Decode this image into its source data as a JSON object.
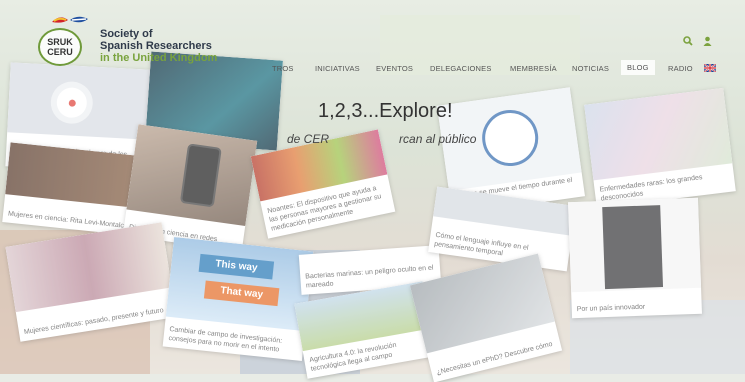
{
  "logo": {
    "badge_line1": "SRUK",
    "badge_line2": "CERU",
    "title_line1": "Society of",
    "title_line2": "Spanish Researchers",
    "title_line3": "in the United Kingdom"
  },
  "nav": {
    "items": [
      "TROS",
      "INICIATIVAS",
      "EVENTOS",
      "DELEGACIONES",
      "MEMBRESÍA",
      "NOTICIAS",
      "BLOG",
      "RADIO"
    ],
    "active": "BLOG"
  },
  "icons": [
    "search-icon",
    "user-icon",
    "uk-flag-icon"
  ],
  "hero": {
    "title": "1,2,3...Explore!",
    "subtitle_left": "de CER",
    "subtitle_right": "rcan al público"
  },
  "cards": [
    {
      "caption": "Una pandemia global en la era de los antibióticos"
    },
    {
      "caption": "Mujeres en ciencia: Rita Levi-Montalcini"
    },
    {
      "caption": "Divulgación ciencia en redes"
    },
    {
      "caption": "Noantes: El dispositivo que ayuda a las personas mayores a gestionar su medicación personalmente"
    },
    {
      "caption": "¿Cómo se mueve el tiempo durante el ejercicio?"
    },
    {
      "caption": "Enfermedades raras: los grandes desconocidos"
    },
    {
      "caption": "Mujeres científicas: pasado, presente y futuro"
    },
    {
      "caption": "Cambiar de campo de investigación: consejos para no morir en el intento"
    },
    {
      "caption": "Bacterias marinas: un peligro oculto en el mareado"
    },
    {
      "caption": "Cómo el lenguaje influye en el pensamiento temporal"
    },
    {
      "caption": "Por un país innovador"
    },
    {
      "caption": "Agricultura 4.0: la revolución tecnológica llega al campo"
    },
    {
      "caption": "¿Necesitas un ePhD? Descubre cómo"
    },
    {
      "sign1": "This way",
      "sign2": "That way"
    }
  ],
  "colors": {
    "brand_green": "#79a33e",
    "brand_navy": "#2f3a4a"
  }
}
